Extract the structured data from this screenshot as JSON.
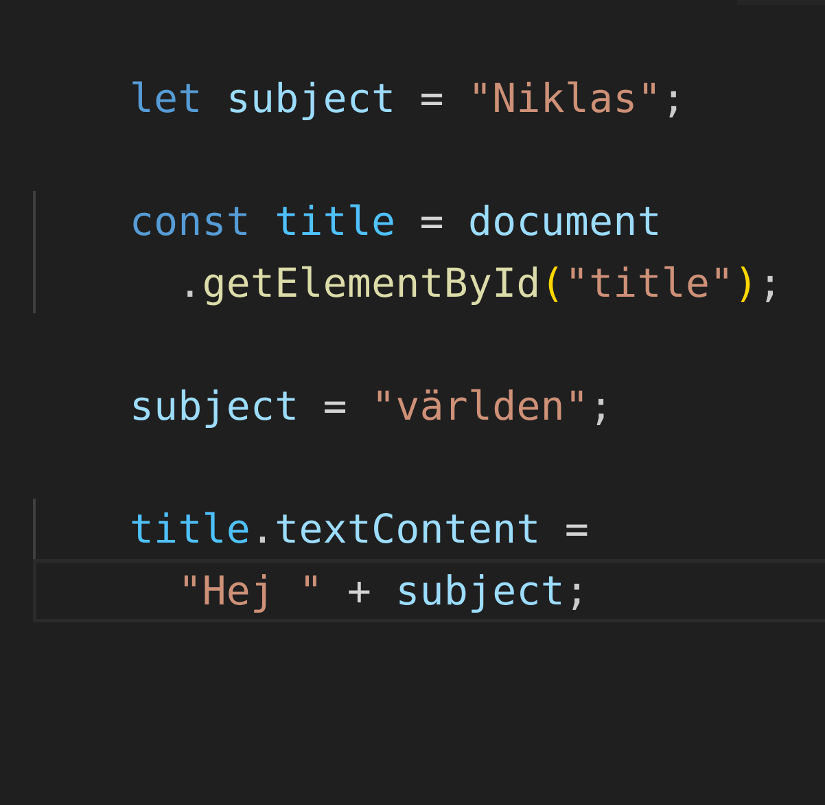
{
  "editor": {
    "lines": [
      {
        "tokens": [
          {
            "text": "let",
            "kind": "keyword"
          },
          {
            "text": " ",
            "kind": "space"
          },
          {
            "text": "subject",
            "kind": "variable"
          },
          {
            "text": " ",
            "kind": "space"
          },
          {
            "text": "=",
            "kind": "operator"
          },
          {
            "text": " ",
            "kind": "space"
          },
          {
            "text": "\"Niklas\"",
            "kind": "string"
          },
          {
            "text": ";",
            "kind": "punctuation"
          }
        ]
      },
      {
        "tokens": [
          {
            "text": "const",
            "kind": "keyword"
          },
          {
            "text": " ",
            "kind": "space"
          },
          {
            "text": "title",
            "kind": "constant"
          },
          {
            "text": " ",
            "kind": "space"
          },
          {
            "text": "=",
            "kind": "operator"
          },
          {
            "text": " ",
            "kind": "space"
          },
          {
            "text": "document",
            "kind": "variable"
          }
        ]
      },
      {
        "tokens": [
          {
            "text": "  ",
            "kind": "space"
          },
          {
            "text": ".",
            "kind": "punctuation"
          },
          {
            "text": "getElementById",
            "kind": "function"
          },
          {
            "text": "(",
            "kind": "paren"
          },
          {
            "text": "\"title\"",
            "kind": "string"
          },
          {
            "text": ")",
            "kind": "paren"
          },
          {
            "text": ";",
            "kind": "punctuation"
          }
        ]
      },
      {
        "tokens": [
          {
            "text": "subject",
            "kind": "variable"
          },
          {
            "text": " ",
            "kind": "space"
          },
          {
            "text": "=",
            "kind": "operator"
          },
          {
            "text": " ",
            "kind": "space"
          },
          {
            "text": "\"världen\"",
            "kind": "string"
          },
          {
            "text": ";",
            "kind": "punctuation"
          }
        ]
      },
      {
        "tokens": [
          {
            "text": "title",
            "kind": "constant"
          },
          {
            "text": ".",
            "kind": "punctuation"
          },
          {
            "text": "textContent",
            "kind": "variable"
          },
          {
            "text": " ",
            "kind": "space"
          },
          {
            "text": "=",
            "kind": "operator"
          }
        ]
      },
      {
        "tokens": [
          {
            "text": "  ",
            "kind": "space"
          },
          {
            "text": "\"Hej \"",
            "kind": "string"
          },
          {
            "text": " ",
            "kind": "space"
          },
          {
            "text": "+",
            "kind": "operator"
          },
          {
            "text": " ",
            "kind": "space"
          },
          {
            "text": "subject",
            "kind": "variable"
          },
          {
            "text": ";",
            "kind": "punctuation"
          }
        ]
      }
    ]
  },
  "colors": {
    "background": "#1f1f1f",
    "keyword": "#569cd6",
    "variable": "#9cdcfe",
    "constant": "#4fc1ff",
    "string": "#ce9178",
    "function": "#dcdcaa",
    "paren": "#ffd700",
    "operator": "#d4d4d4"
  }
}
